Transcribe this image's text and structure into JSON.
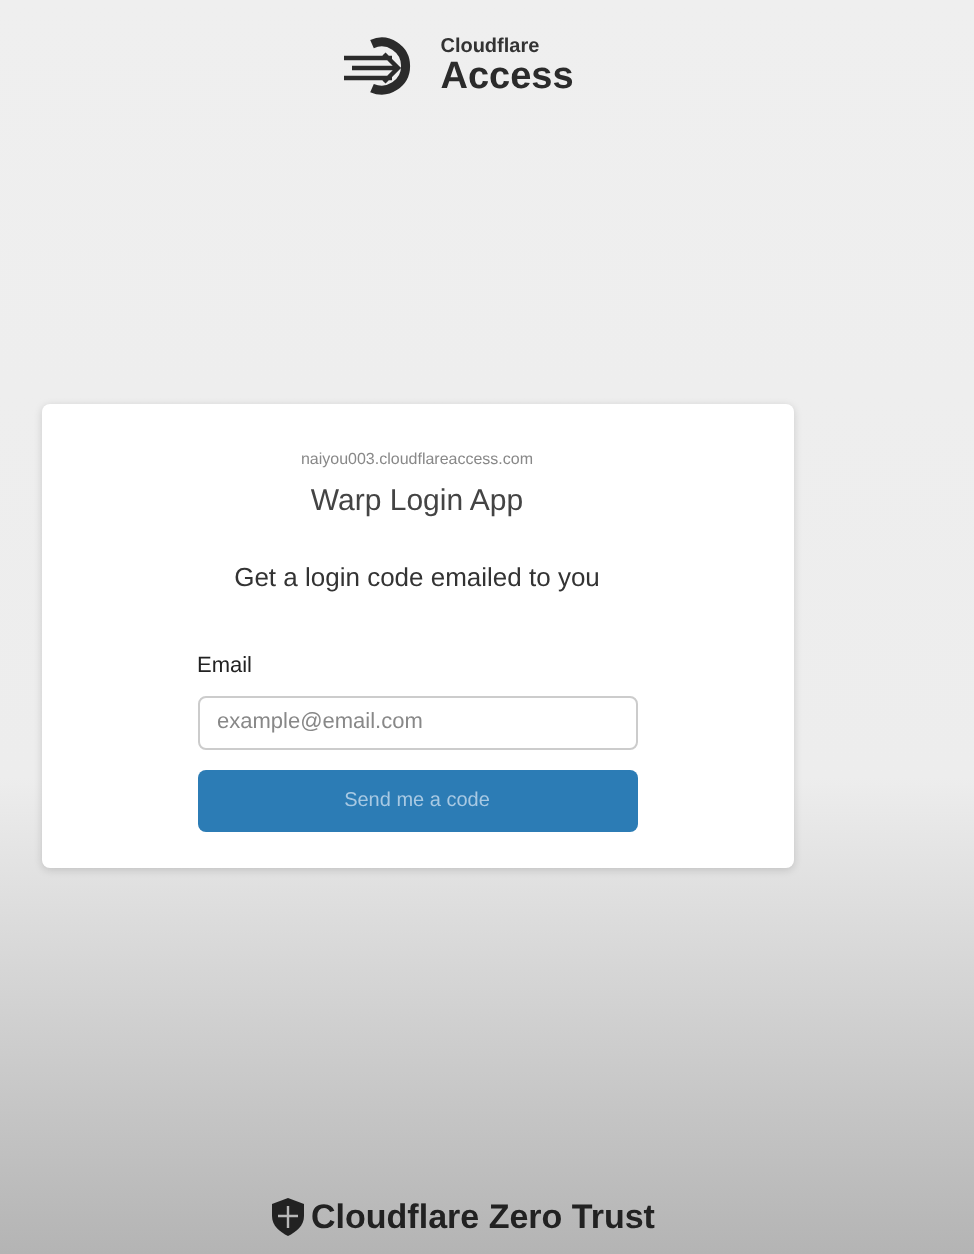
{
  "header": {
    "brand_small": "Cloudflare",
    "brand_large": "Access"
  },
  "card": {
    "domain": "naiyou003.cloudflareaccess.com",
    "app_name": "Warp Login App",
    "heading": "Get a login code emailed to you",
    "email_label": "Email",
    "email_placeholder": "example@email.com",
    "button": "Send me a code"
  },
  "footer": {
    "brand": "Cloudflare Zero Trust"
  }
}
